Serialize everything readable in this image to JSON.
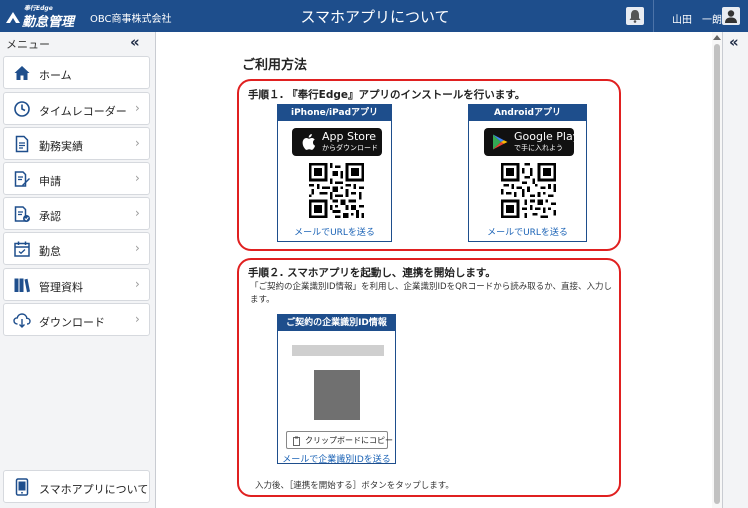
{
  "header": {
    "logo_sub": "奉行Edge",
    "logo_main": "勤怠管理",
    "company": "OBC商事株式会社",
    "title": "スマホアプリについて",
    "username": "山田　一朗"
  },
  "sidebar": {
    "menu_label": "メニュー",
    "collapse_label": "«",
    "items": [
      {
        "label": "ホーム",
        "icon": "home-icon",
        "arrow": ""
      },
      {
        "label": "タイムレコーダー",
        "icon": "clock-icon",
        "arrow": "›"
      },
      {
        "label": "勤務実績",
        "icon": "document-icon",
        "arrow": "›"
      },
      {
        "label": "申請",
        "icon": "edit-document-icon",
        "arrow": "›"
      },
      {
        "label": "承認",
        "icon": "approve-document-icon",
        "arrow": "›"
      },
      {
        "label": "勤怠",
        "icon": "calendar-icon",
        "arrow": "›"
      },
      {
        "label": "管理資料",
        "icon": "books-icon",
        "arrow": "›"
      },
      {
        "label": "ダウンロード",
        "icon": "cloud-download-icon",
        "arrow": "›"
      }
    ],
    "bottom_item": {
      "label": "スマホアプリについて",
      "icon": "smartphone-icon"
    }
  },
  "right_rail": {
    "collapse_label": "«"
  },
  "main": {
    "usage_title": "ご利用方法",
    "step1": {
      "title": "手順１. 『奉行Edge』アプリのインストールを行います。",
      "ios": {
        "header": "iPhone/iPadアプリ",
        "store_main": "App Store",
        "store_sub": "からダウンロード",
        "link": "メールでURLを送る"
      },
      "android": {
        "header": "Androidアプリ",
        "store_main": "Google Play",
        "store_sub": "で手に入れよう",
        "link": "メールでURLを送る"
      }
    },
    "step2": {
      "title": "手順２. スマホアプリを起動し、連携を開始します。",
      "description": "「ご契約の企業識別ID情報」を利用し、企業識別IDをQRコードから読み取るか、直接、入力します。",
      "card_header": "ご契約の企業識別ID情報",
      "copy_button": "クリップボードにコピー",
      "link": "メールで企業識別IDを送る",
      "after_text": "入力後、［連携を開始する］ボタンをタップします。"
    }
  },
  "colors": {
    "header_bg": "#1e4e8c",
    "highlight_border": "#e02020",
    "link": "#1b63b6"
  }
}
